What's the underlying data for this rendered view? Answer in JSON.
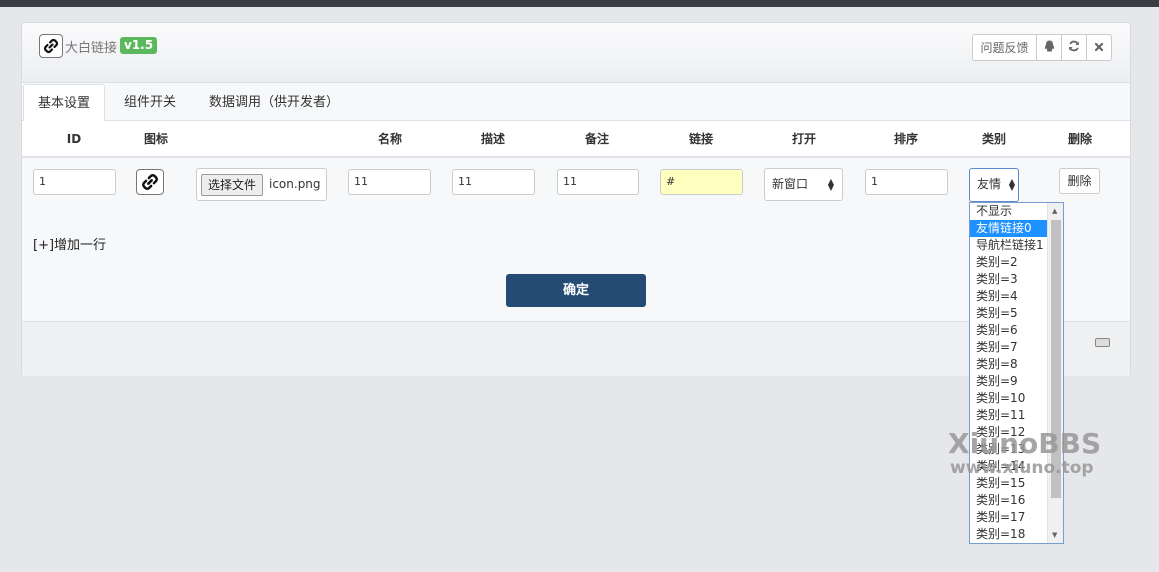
{
  "header": {
    "title": "大白链接",
    "version": "v1.5",
    "feedback_label": "问题反馈"
  },
  "tabs": [
    {
      "label": "基本设置",
      "active": true
    },
    {
      "label": "组件开关",
      "active": false
    },
    {
      "label": "数据调用（供开发者）",
      "active": false
    }
  ],
  "table": {
    "headers": [
      "ID",
      "图标",
      "名称",
      "描述",
      "备注",
      "链接",
      "打开",
      "排序",
      "类别",
      "删除"
    ],
    "row": {
      "id": "1",
      "file_button": "选择文件",
      "file_name": "icon.png",
      "name": "11",
      "desc": "11",
      "note": "11",
      "link": "#",
      "open": "新窗口",
      "sort": "1",
      "category": "友情",
      "delete": "删除"
    }
  },
  "add_row": "[+]增加一行",
  "confirm": "确定",
  "category_options": [
    "不显示",
    "友情链接0",
    "导航栏链接1",
    "类别=2",
    "类别=3",
    "类别=4",
    "类别=5",
    "类别=6",
    "类别=7",
    "类别=8",
    "类别=9",
    "类别=10",
    "类别=11",
    "类别=12",
    "类别=13",
    "类别=14",
    "类别=15",
    "类别=16",
    "类别=17",
    "类别=18"
  ],
  "selected_option": "友情链接0",
  "watermark": {
    "line1": "XiunoBBS",
    "line2": "www.xiuno.top"
  },
  "colors": {
    "accent": "#254b74",
    "version_badge": "#5cb85c",
    "selected": "#1e90ff"
  }
}
